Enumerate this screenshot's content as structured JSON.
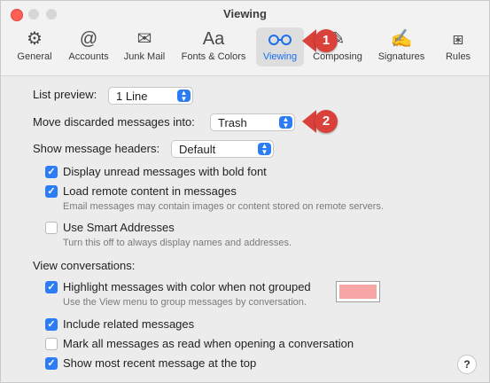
{
  "window": {
    "title": "Viewing"
  },
  "toolbar": {
    "items": [
      {
        "label": "General",
        "icon": "gear-icon",
        "glyph": "⚙"
      },
      {
        "label": "Accounts",
        "icon": "at-icon",
        "glyph": "@"
      },
      {
        "label": "Junk Mail",
        "icon": "junk-mail-icon",
        "glyph": "✉"
      },
      {
        "label": "Fonts & Colors",
        "icon": "fonts-icon",
        "glyph": "Aa"
      },
      {
        "label": "Viewing",
        "icon": "glasses-icon",
        "glyph": "○○"
      },
      {
        "label": "Composing",
        "icon": "compose-icon",
        "glyph": "✎"
      },
      {
        "label": "Signatures",
        "icon": "signature-icon",
        "glyph": "✍"
      },
      {
        "label": "Rules",
        "icon": "rules-icon",
        "glyph": "⧆"
      }
    ],
    "selected": "Viewing"
  },
  "callouts": [
    "1",
    "2"
  ],
  "settings": {
    "list_preview_label": "List preview:",
    "list_preview_value": "1 Line",
    "move_discarded_label": "Move discarded messages into:",
    "move_discarded_value": "Trash",
    "show_headers_label": "Show message headers:",
    "show_headers_value": "Default",
    "bold_unread": {
      "label": "Display unread messages with bold font",
      "checked": true
    },
    "load_remote": {
      "label": "Load remote content in messages",
      "checked": true,
      "hint": "Email messages may contain images or content stored on remote servers."
    },
    "smart_addresses": {
      "label": "Use Smart Addresses",
      "checked": false,
      "hint": "Turn this off to always display names and addresses."
    },
    "view_conversations_label": "View conversations:",
    "highlight": {
      "label": "Highlight messages with color when not grouped",
      "checked": true,
      "hint": "Use the View menu to group messages by conversation.",
      "color": "#f7a5a5"
    },
    "include_related": {
      "label": "Include related messages",
      "checked": true
    },
    "mark_read": {
      "label": "Mark all messages as read when opening a conversation",
      "checked": false
    },
    "most_recent_top": {
      "label": "Show most recent message at the top",
      "checked": true
    }
  },
  "help": "?"
}
